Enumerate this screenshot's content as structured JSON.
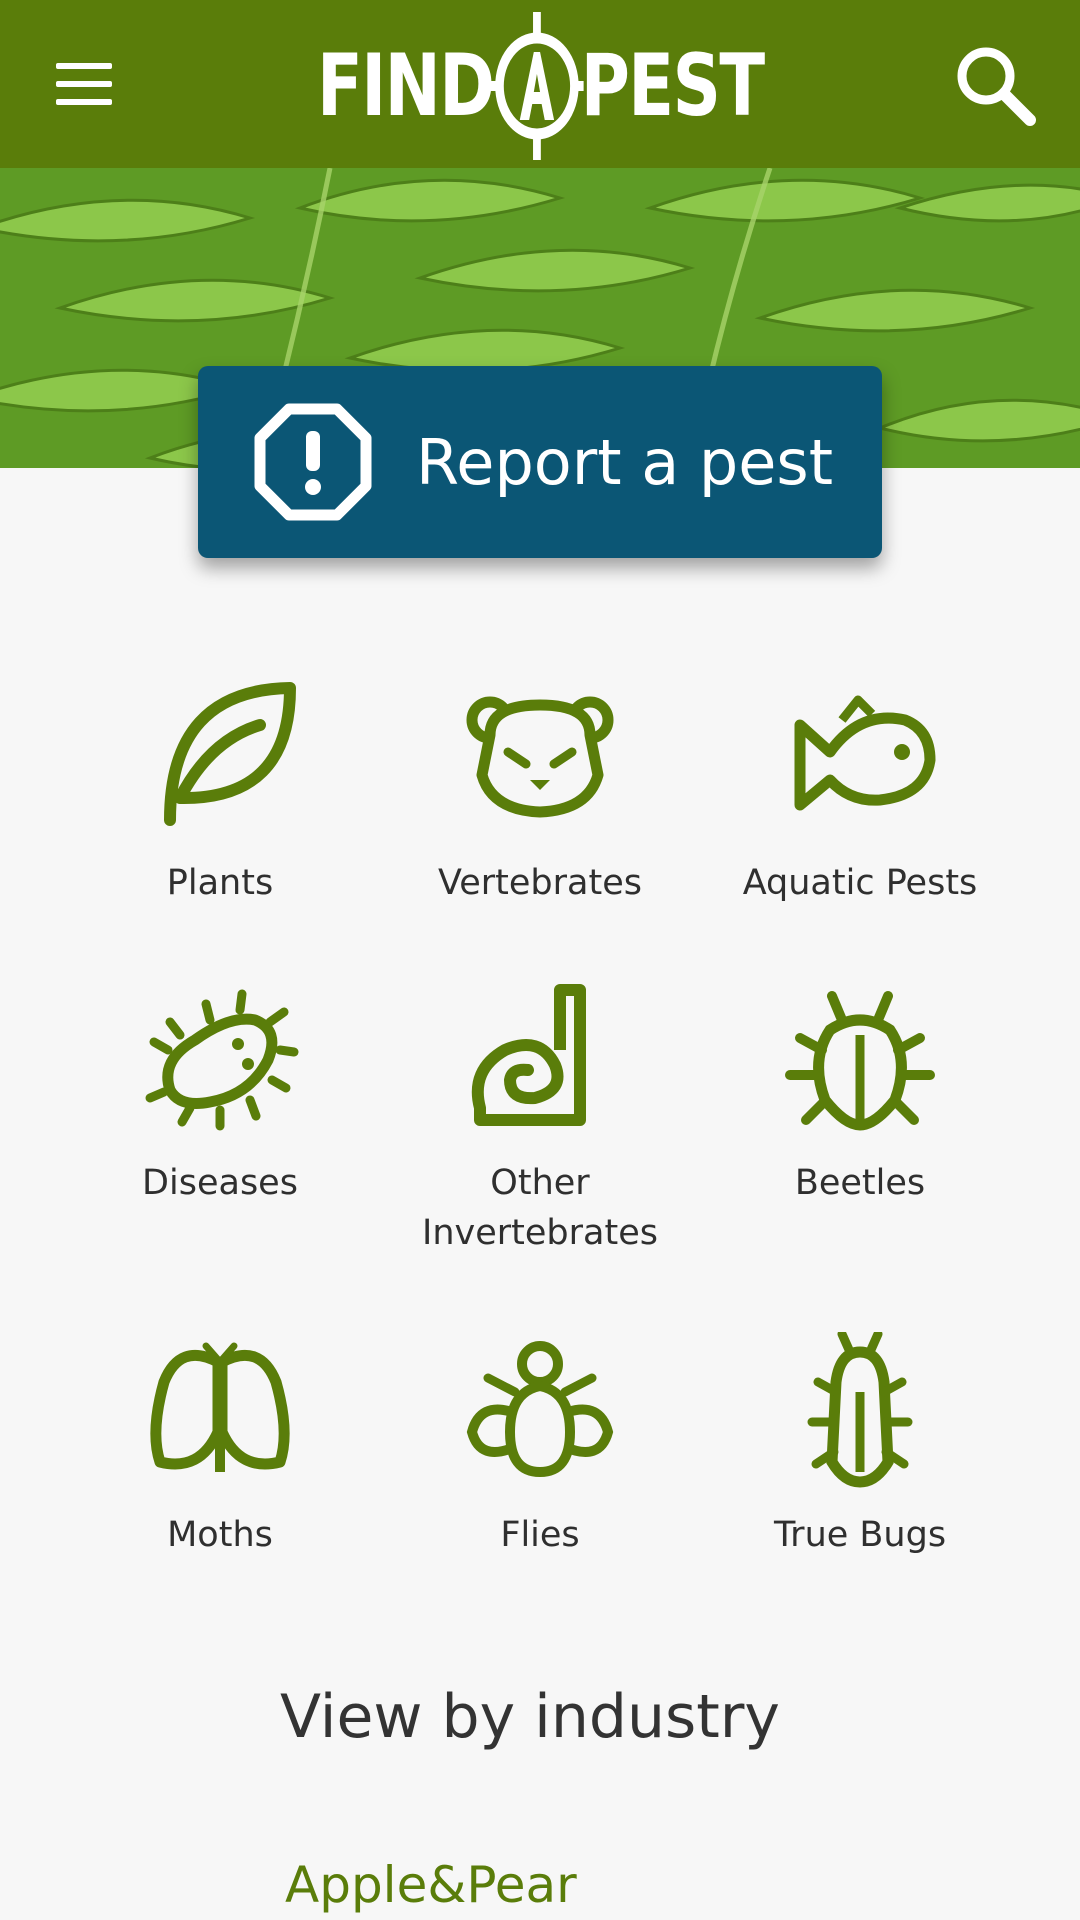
{
  "header": {
    "logo_text_left": "FIND",
    "logo_text_right": "PEST",
    "brand_color": "#5a7d0a"
  },
  "report": {
    "label": "Report a pest",
    "icon": "alert-octagon-icon",
    "color": "#0b5675"
  },
  "categories": [
    {
      "label": "Plants",
      "icon": "leaf-icon"
    },
    {
      "label": "Vertebrates",
      "icon": "animal-face-icon"
    },
    {
      "label": "Aquatic Pests",
      "icon": "fish-icon"
    },
    {
      "label": "Diseases",
      "icon": "bacteria-icon"
    },
    {
      "label": "Other Invertebrates",
      "icon": "snail-icon"
    },
    {
      "label": "Beetles",
      "icon": "beetle-icon"
    },
    {
      "label": "Moths",
      "icon": "moth-icon"
    },
    {
      "label": "Flies",
      "icon": "fly-icon"
    },
    {
      "label": "True Bugs",
      "icon": "true-bug-icon"
    }
  ],
  "industry": {
    "title": "View by industry",
    "items": [
      "Apple&Pear"
    ]
  }
}
